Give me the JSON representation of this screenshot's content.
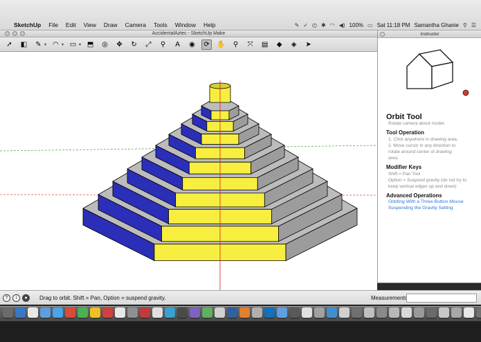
{
  "menubar": {
    "apple": "",
    "app_name": "SketchUp",
    "items": [
      "File",
      "Edit",
      "View",
      "Draw",
      "Camera",
      "Tools",
      "Window",
      "Help"
    ],
    "battery": "100%",
    "clock": "Sat 11:18 PM",
    "user": "Samantha Ghanie"
  },
  "window": {
    "title": "AccidentalAztec - SketchUp Make"
  },
  "toolbar": {
    "tools": [
      {
        "name": "select",
        "glyph": "➚"
      },
      {
        "name": "eraser",
        "glyph": "◧"
      },
      {
        "name": "line",
        "glyph": "✎"
      },
      {
        "name": "arc",
        "glyph": "◠"
      },
      {
        "name": "shape",
        "glyph": "▭"
      },
      {
        "name": "push-pull",
        "glyph": "⬒"
      },
      {
        "name": "offset",
        "glyph": "◎"
      },
      {
        "name": "move",
        "glyph": "✥"
      },
      {
        "name": "rotate",
        "glyph": "↻"
      },
      {
        "name": "scale",
        "glyph": "⤢"
      },
      {
        "name": "tape-measure",
        "glyph": "⚲"
      },
      {
        "name": "text",
        "glyph": "A"
      },
      {
        "name": "paint-bucket",
        "glyph": "◉"
      },
      {
        "name": "orbit",
        "glyph": "⟳"
      },
      {
        "name": "pan",
        "glyph": "✋"
      },
      {
        "name": "zoom",
        "glyph": "⚲"
      },
      {
        "name": "zoom-extents",
        "glyph": "⤧"
      },
      {
        "name": "warehouse",
        "glyph": "▤"
      },
      {
        "name": "extensions",
        "glyph": "◆"
      },
      {
        "name": "share-model",
        "glyph": "◈"
      },
      {
        "name": "layout",
        "glyph": "➤"
      }
    ]
  },
  "instructor": {
    "panel_title": "Instructor",
    "tool_name": "Orbit Tool",
    "tool_desc": "Rotate camera about model.",
    "operation_heading": "Tool Operation",
    "operation_lines": [
      "1.  Click anywhere in drawing area.",
      "2.  Move cursor in any direction to",
      "     rotate around center of drawing",
      "     area."
    ],
    "modifier_heading": "Modifier Keys",
    "modifier_lines": [
      "Shift = Pan Tool",
      "Option = Suspend gravity (do not try to",
      "keep vertical edges up and down)"
    ],
    "advanced_heading": "Advanced Operations",
    "advanced_links": [
      "Orbiting With a Three-Button Mouse",
      "Suspending the Gravity Setting"
    ]
  },
  "statusbar": {
    "hint": "Drag to orbit. Shift = Pan, Option = suspend gravity.",
    "measurements_label": "Measurements",
    "measurements_value": ""
  },
  "colors": {
    "side_yellow": "#f7ee3f",
    "side_blue": "#2b2fb8",
    "top_gray": "#bcbcbc",
    "axis_red": "#d02020",
    "axis_green": "#3aa83a"
  },
  "dock_icon_colors": [
    "#6b6b6b",
    "#3a78c4",
    "#e8e8e8",
    "#5aa0e0",
    "#4aa4e8",
    "#d94b3b",
    "#4caf50",
    "#f0c020",
    "#d04040",
    "#e8e8e8",
    "#909090",
    "#c23b3b",
    "#e0e0e0",
    "#3aa0d0",
    "#4a4a4a",
    "#8060c0",
    "#60b060",
    "#d0d0d0",
    "#3060a0",
    "#e08030",
    "#b0b0b0",
    "#1070c0",
    "#60a0e0",
    "#5a5a5a",
    "#e0e0e0",
    "#a0a0a0",
    "#4090d0",
    "#d0d0d0",
    "#707070",
    "#c0c0c0",
    "#8a8a8a",
    "#b8b8b8",
    "#d8d8d8",
    "#9a9a9a",
    "#6a6a6a",
    "#c8c8c8",
    "#a8a8a8",
    "#e8e8e8",
    "#707070",
    "#909090",
    "#c0c0c0"
  ]
}
